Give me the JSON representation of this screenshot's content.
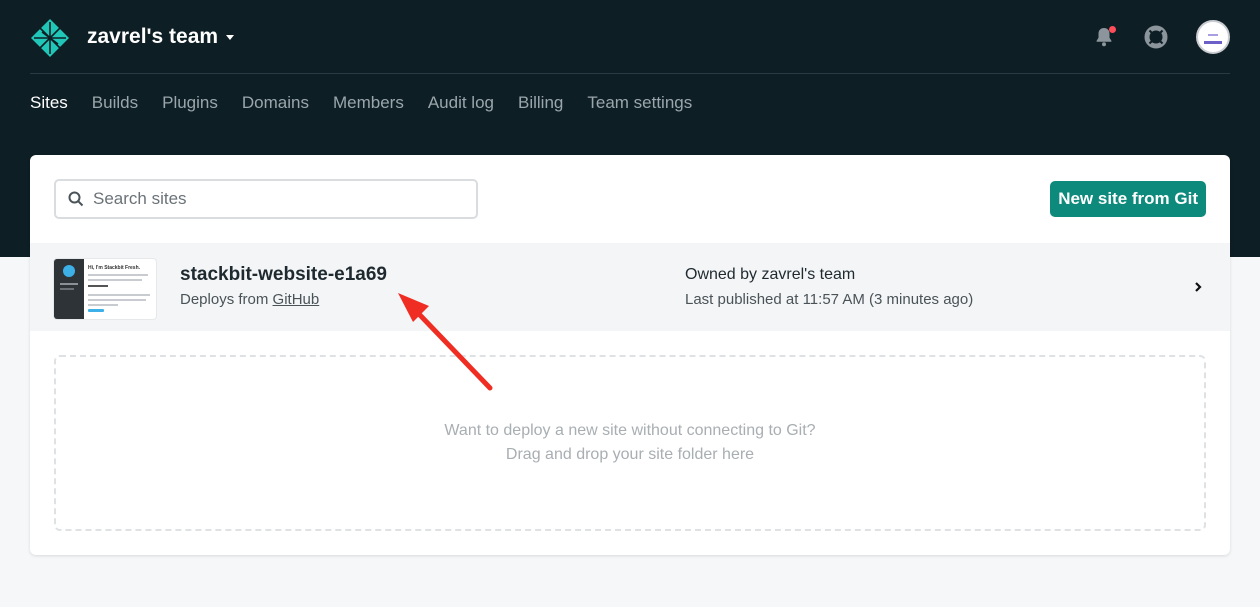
{
  "header": {
    "team_name": "zavrel's team",
    "icons": [
      "netlify-logo",
      "caret-down-icon",
      "bell-icon",
      "help-icon",
      "avatar"
    ],
    "notification_dot_color": "#ff4d5a"
  },
  "nav": {
    "items": [
      "Sites",
      "Builds",
      "Plugins",
      "Domains",
      "Members",
      "Audit log",
      "Billing",
      "Team settings"
    ],
    "active": "Sites"
  },
  "search": {
    "placeholder": "Search sites",
    "value": ""
  },
  "new_site_button": "New site from Git",
  "site": {
    "name": "stackbit-website-e1a69",
    "deploys_prefix": "Deploys from",
    "deploys_source": "GitHub",
    "owner": "Owned by zavrel's team",
    "published": "Last published at 11:57 AM (3 minutes ago)",
    "thumbnail_heading": "Hi, I'm Stackbit Fresh."
  },
  "dropzone": {
    "line1": "Want to deploy a new site without connecting to Git?",
    "line2": "Drag and drop your site folder here"
  },
  "colors": {
    "header_bg": "#0e1e25",
    "accent": "#0e8a7d",
    "annotation_arrow": "#f02d22"
  }
}
